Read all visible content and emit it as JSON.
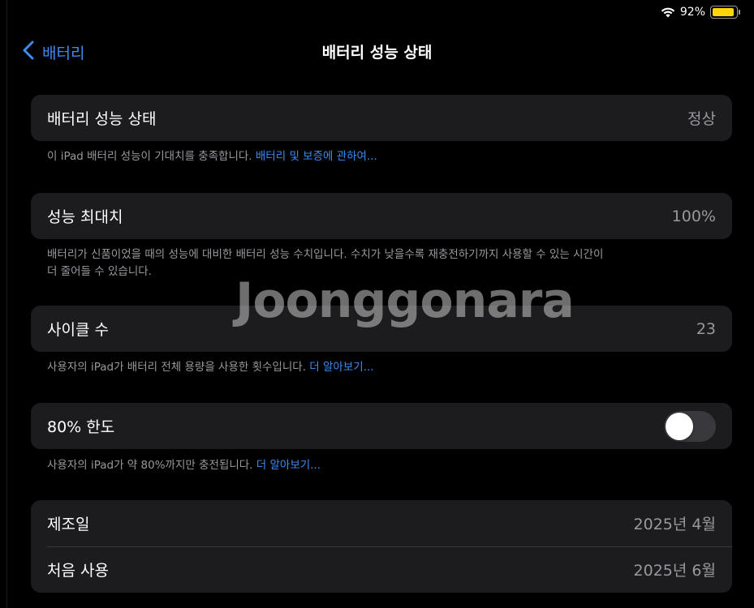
{
  "status": {
    "battery_percent_text": "92%",
    "battery_level": 0.92,
    "battery_color": "#ffd60a"
  },
  "nav": {
    "back_label": "배터리",
    "title": "배터리 성능 상태",
    "accent": "#3b8cf5"
  },
  "health": {
    "label": "배터리 성능 상태",
    "value": "정상",
    "footnote_text": "이 iPad 배터리 성능이 기대치를 충족합니다. ",
    "footnote_link": "배터리 및 보증에 관하여..."
  },
  "max_capacity": {
    "label": "성능 최대치",
    "value": "100%",
    "footnote_line1": "배터리가 신품이었을 때의 성능에 대비한 배터리 성능 수치입니다. 수치가 낮을수록 재충전하기까지 사용할 수 있는 시간이",
    "footnote_line2": "더 줄어들 수 있습니다."
  },
  "cycle_count": {
    "label": "사이클 수",
    "value": "23",
    "footnote_text": "사용자의 iPad가 배터리 전체 용량을 사용한 횟수입니다. ",
    "footnote_link": "더 알아보기..."
  },
  "limit_80": {
    "label": "80% 한도",
    "toggle_on": false,
    "toggle_off_color": "#39393d",
    "footnote_text": "사용자의 iPad가 약 80%까지만 충전됩니다. ",
    "footnote_link": "더 알아보기..."
  },
  "dates": {
    "manufacture_label": "제조일",
    "manufacture_value": "2025년 4월",
    "first_use_label": "처음 사용",
    "first_use_value": "2025년 6월"
  },
  "watermark": {
    "text": "Joonggonara"
  }
}
